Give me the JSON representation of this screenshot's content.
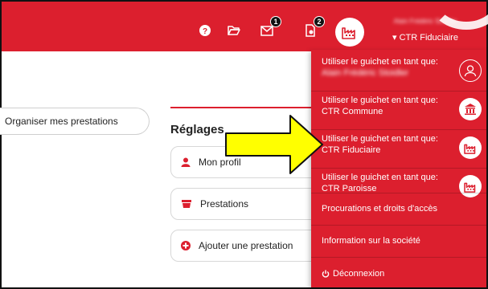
{
  "topbar": {
    "help_icon": "question-circle-icon",
    "folder_icon": "folder-open-icon",
    "mail_icon": "mail-icon",
    "mail_badge": "1",
    "doc_icon": "document-gear-icon",
    "doc_badge": "2",
    "avatar_icon": "factory-icon",
    "user_name": "Alain Frédéric Stoidler",
    "user_role": "▾ CTR Fiduciaire"
  },
  "left_panel": {
    "pill_label": "Organiser mes prestations"
  },
  "settings": {
    "title": "Réglages",
    "cards": [
      {
        "label": "Mon profil",
        "icon": "user-icon"
      },
      {
        "label": "Prestations",
        "icon": "basket-icon"
      },
      {
        "label": "Ajouter une prestation",
        "icon": "plus-circle-icon"
      }
    ]
  },
  "menu": {
    "items": [
      {
        "line1": "Utiliser le guichet en tant que:",
        "line2": "Alain Frédéric Stoidler",
        "icon": "user-outline-icon"
      },
      {
        "line1": "Utiliser le guichet en tant que:",
        "line2": "CTR Commune",
        "icon": "townhall-icon"
      },
      {
        "line1": "Utiliser le guichet en tant que:",
        "line2": "CTR Fiduciaire",
        "icon": "factory-icon"
      },
      {
        "line1": "Utiliser le guichet en tant que:",
        "line2": "CTR Paroisse",
        "icon": "factory-icon"
      }
    ],
    "procurations": "Procurations et droits d'accès",
    "company_info": "Information sur la société",
    "logout": "Déconnexion",
    "logout_icon": "power-icon"
  },
  "colors": {
    "brand_red": "#dc1f2e",
    "arrow_yellow": "#ffff00"
  }
}
